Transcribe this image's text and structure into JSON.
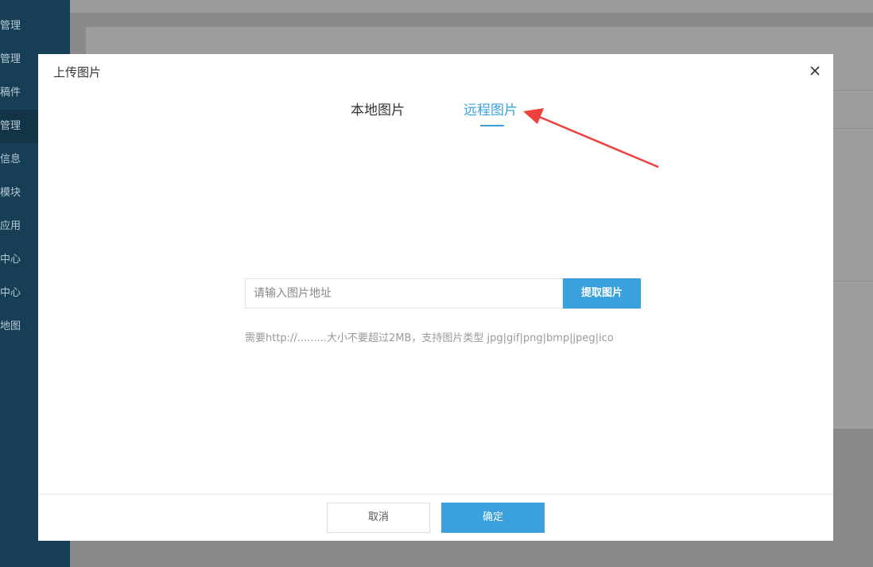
{
  "sidebar": {
    "items": [
      {
        "label": "管理"
      },
      {
        "label": "管理"
      },
      {
        "label": "稿件"
      },
      {
        "label": "管理"
      },
      {
        "label": "信息"
      },
      {
        "label": "模块"
      },
      {
        "label": "应用"
      },
      {
        "label": "中心"
      },
      {
        "label": "中心"
      },
      {
        "label": "地图"
      }
    ]
  },
  "modal": {
    "title": "上传图片",
    "close_icon": "close-icon",
    "tabs": [
      {
        "label": "本地图片",
        "active": false
      },
      {
        "label": "远程图片",
        "active": true
      }
    ],
    "url_input": {
      "placeholder": "请输入图片地址",
      "value": ""
    },
    "fetch_button": "提取图片",
    "hint": "需要http://.........大小不要超过2MB，支持图片类型 jpg|gif|png|bmp|jpeg|ico",
    "footer": {
      "cancel_label": "取消",
      "confirm_label": "确定"
    }
  },
  "colors": {
    "accent": "#3aa1dc",
    "annotation_arrow": "#f0403c"
  }
}
